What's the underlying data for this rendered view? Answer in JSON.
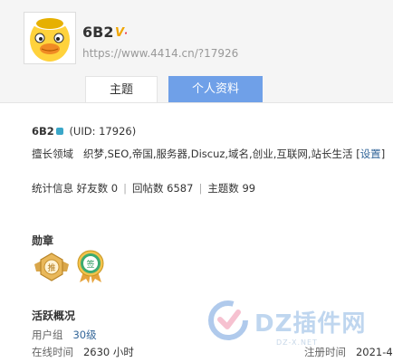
{
  "profile": {
    "username": "6B2",
    "verified_badge": "V",
    "url": "https://www.4414.cn/?17926",
    "avatar_icon": "duck-avatar-icon"
  },
  "tabs": [
    {
      "label": "主题",
      "active": false
    },
    {
      "label": "个人资料",
      "active": true
    }
  ],
  "info": {
    "name": "6B2",
    "uid": "(UID: 17926)",
    "expertise_label": "擅长领域",
    "expertise_value": "织梦,SEO,帝国,服务器,Discuz,域名,创业,互联网,站长生活",
    "settings_link": "设置",
    "bracket_open": "[",
    "bracket_close": "]",
    "stats_label": "统计信息",
    "friends": "好友数 0",
    "replies": "回帖数 6587",
    "threads": "主题数 99",
    "separator": "|"
  },
  "medals": {
    "title": "勋章",
    "items": [
      {
        "name": "medal-gold-icon",
        "text": "推"
      },
      {
        "name": "medal-green-icon",
        "text": "签"
      }
    ]
  },
  "activity": {
    "title": "活跃概况",
    "group_label": "用户组",
    "group_value": "30级",
    "online_label": "在线时间",
    "online_value": "2630 小时",
    "register_label": "注册时间",
    "register_value": "2021-4"
  },
  "watermark": {
    "text": "DZ插件网",
    "sub": "DZ-X.NET"
  },
  "colors": {
    "tab_active": "#6fa0e8",
    "link": "#336699",
    "watermark": "#bfd6ef"
  }
}
